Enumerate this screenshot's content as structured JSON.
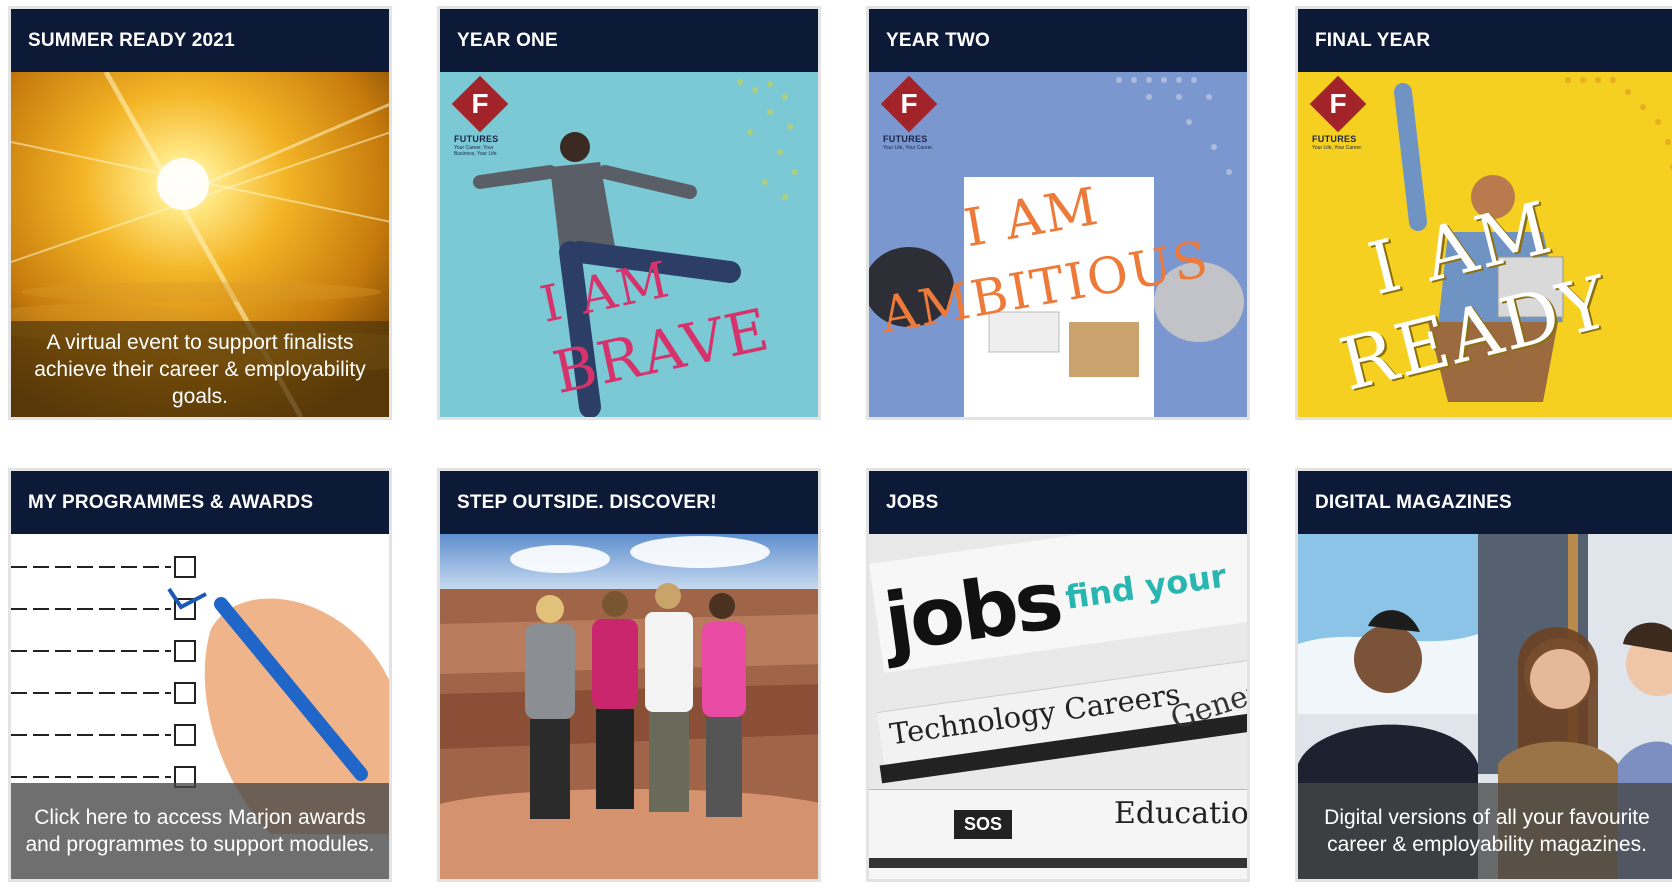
{
  "tiles": [
    {
      "title": "SUMMER READY 2021",
      "caption": "A virtual event to support finalists achieve their career & employability goals.",
      "image": "sunrise-over-clouds"
    },
    {
      "title": "YEAR ONE",
      "image": "student-leaping",
      "logo": {
        "letter": "F",
        "word": "FUTURES",
        "tagline": "Your Career, Your Business, Your Life."
      },
      "slogan": {
        "line1": "I AM",
        "line2": "BRAVE"
      }
    },
    {
      "title": "YEAR TWO",
      "image": "handshake-over-desk",
      "logo": {
        "letter": "F",
        "word": "FUTURES",
        "tagline": "Your Life, Your Career."
      },
      "slogan": {
        "line1": "I AM",
        "line2": "AMBITIOUS"
      }
    },
    {
      "title": "FINAL YEAR",
      "image": "cheering-student-with-tablet",
      "logo": {
        "letter": "F",
        "word": "FUTURES",
        "tagline": "Your Life, Your Career."
      },
      "slogan": {
        "line1": "I AM",
        "line2": "READY"
      }
    },
    {
      "title": "MY PROGRAMMES & AWARDS",
      "caption": "Click here to access Marjon awards and programmes to support modules.",
      "image": "hand-ticking-checklist"
    },
    {
      "title": "STEP OUTSIDE. DISCOVER!",
      "image": "friends-at-grand-canyon"
    },
    {
      "title": "JOBS",
      "image": "jobs-newspaper",
      "newspaper": {
        "headline": "jobs",
        "tagline": "find your",
        "section1": "Technology Careers",
        "section2": "General",
        "section3": "Education",
        "badge": "SOS"
      }
    },
    {
      "title": "DIGITAL MAGAZINES",
      "caption": "Digital versions of all your favourite career & employability magazines.",
      "image": "students-smiling"
    }
  ],
  "colors": {
    "header_bg": "#0d1a37",
    "border": "#e3e3e3",
    "futures_red": "#a3232a",
    "brave_pink": "#d6336c",
    "ambitious_orange": "#ee7a3a"
  }
}
